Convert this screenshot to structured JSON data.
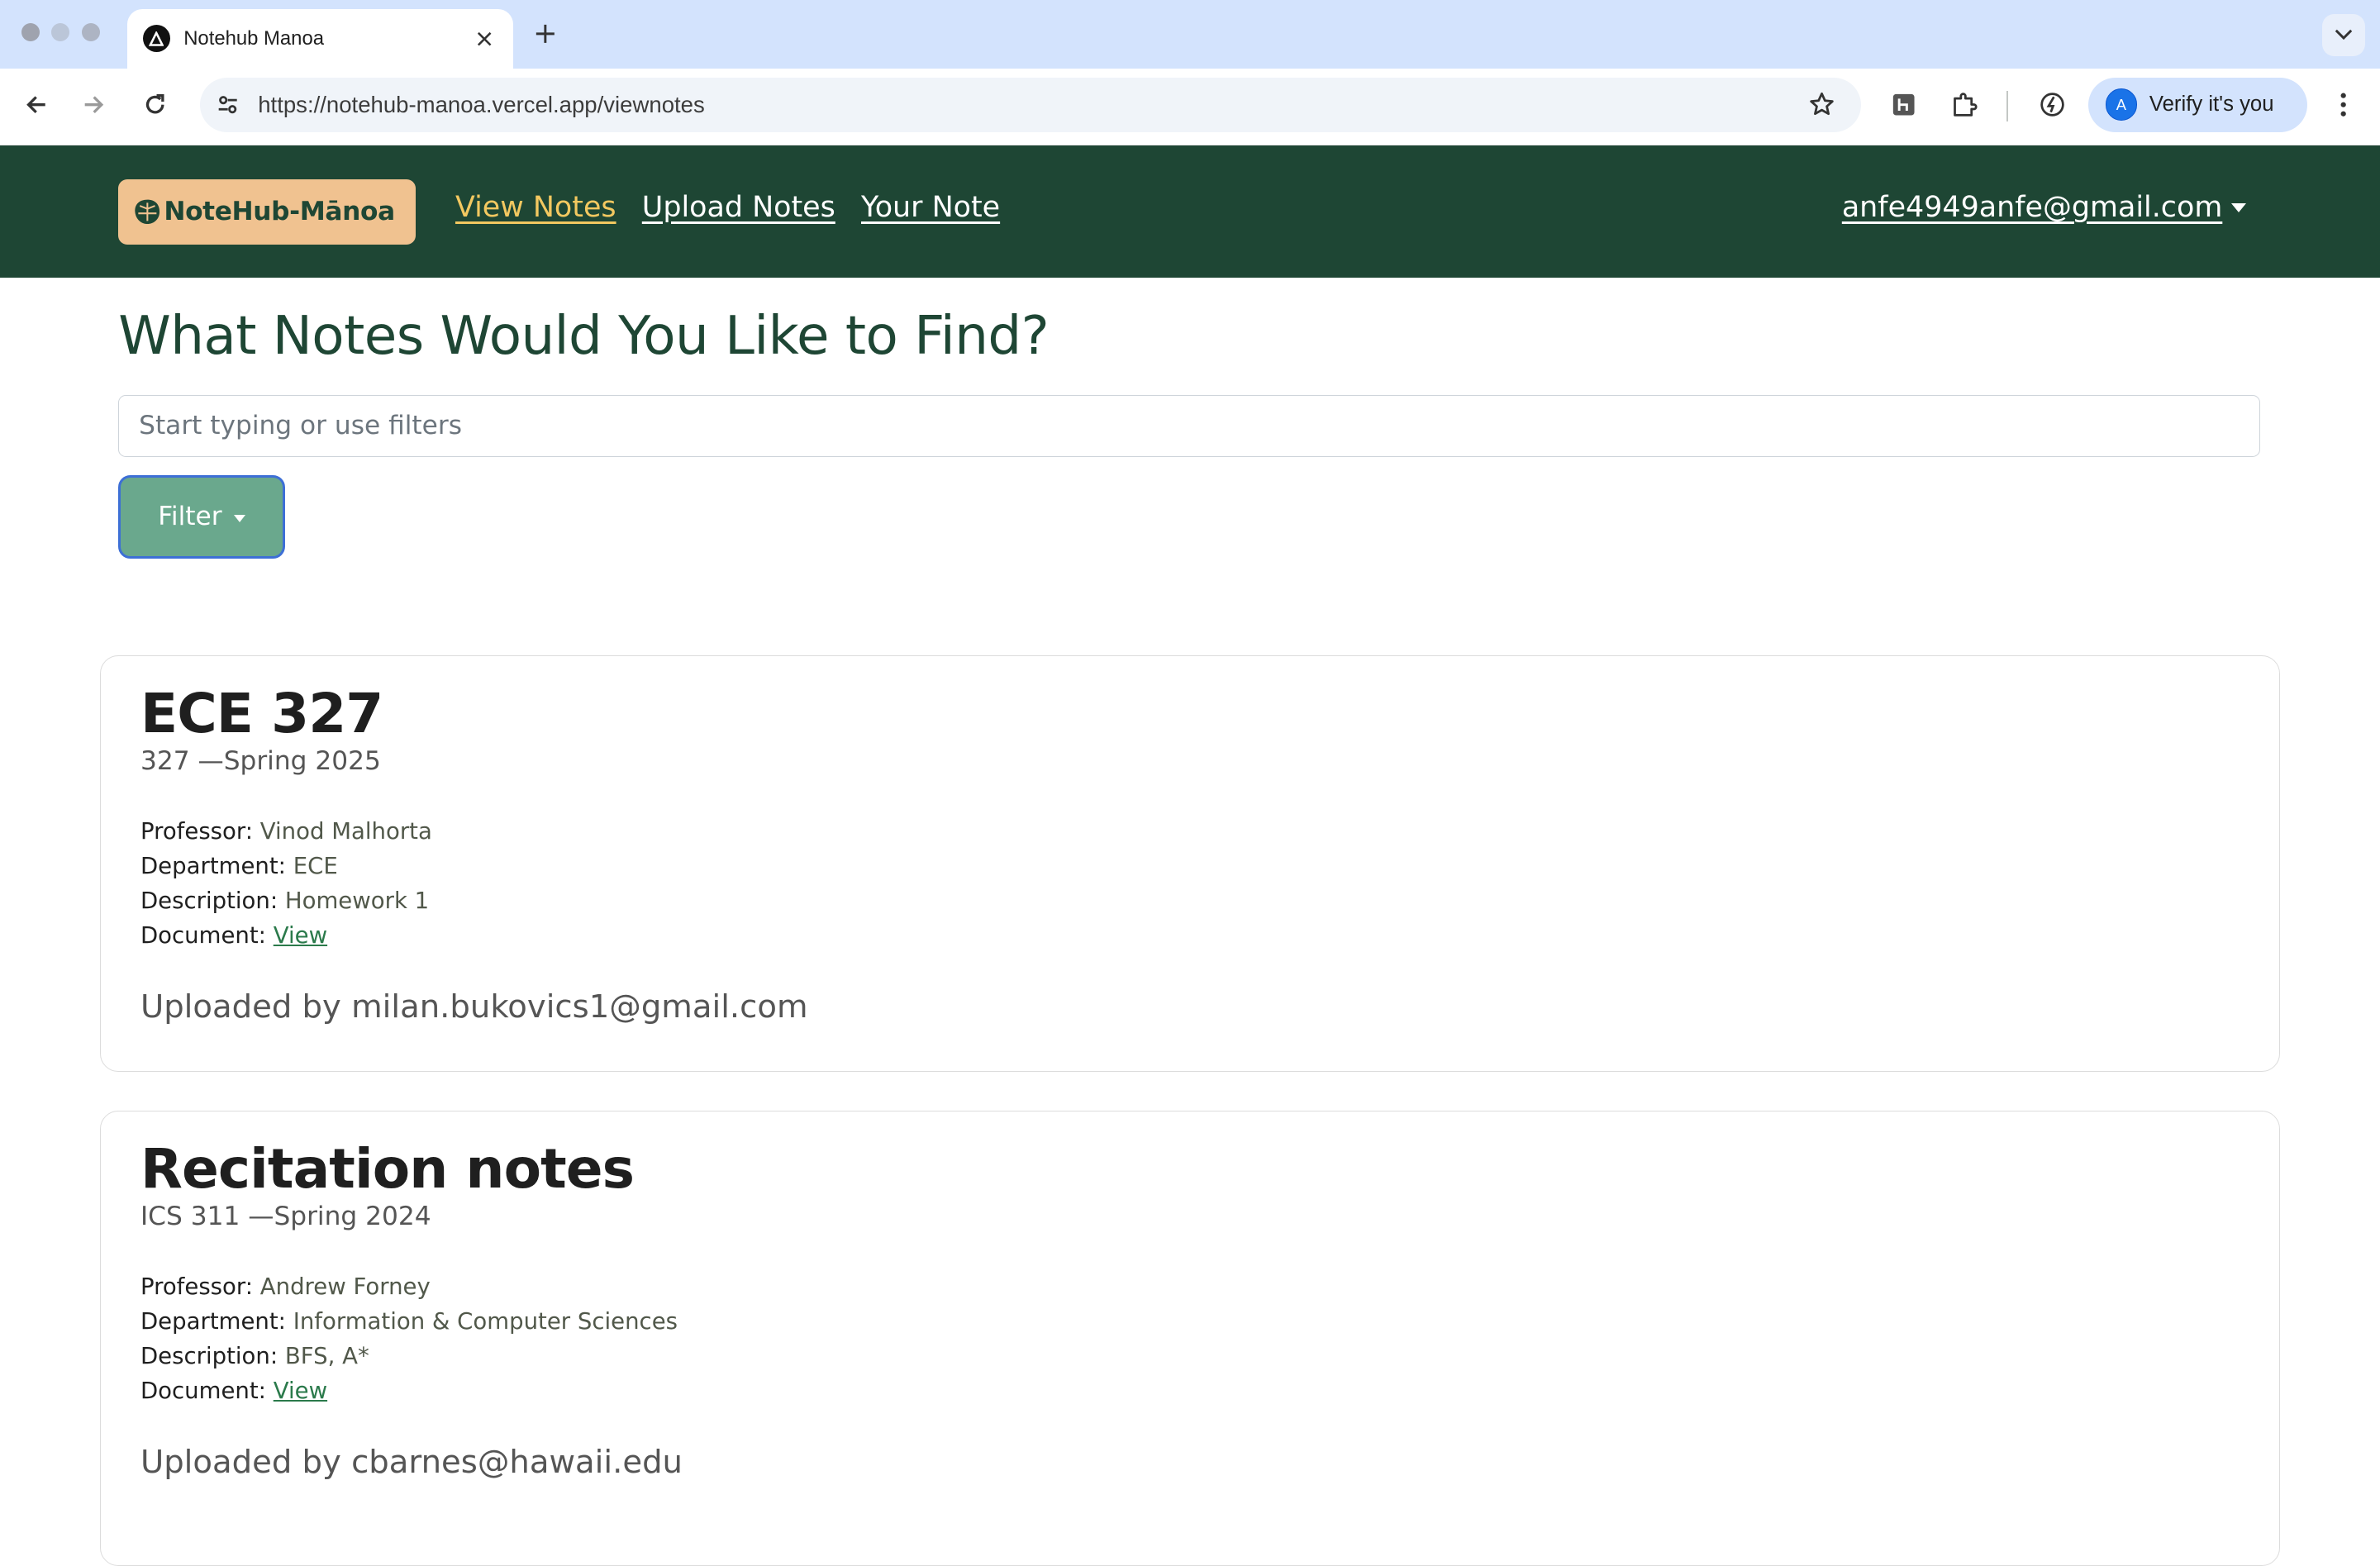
{
  "browser": {
    "tab_title": "Notehub Manoa",
    "url": "https://notehub-manoa.vercel.app/viewnotes",
    "profile_button_label": "Verify it's you",
    "icons": [
      "back-icon",
      "forward-icon",
      "reload-icon",
      "tune-icon",
      "star-icon",
      "extension-h-icon",
      "puzzle-icon",
      "performance-icon",
      "kebab-menu-icon",
      "new-tab-icon",
      "tab-search-icon",
      "close-icon"
    ]
  },
  "site": {
    "brand": "NoteHub-Mānoa",
    "nav": [
      {
        "label": "View Notes",
        "active": true
      },
      {
        "label": "Upload Notes",
        "active": false
      },
      {
        "label": "Your Note",
        "active": false
      }
    ],
    "user_email": "anfe4949anfe@gmail.com",
    "colors": {
      "navbar": "#1e4634",
      "brand_bg": "#f0c290",
      "active_link": "#f3c860",
      "filter_button": "#6aa88d"
    }
  },
  "page": {
    "title": "What Notes Would You Like to Find?",
    "search_placeholder": "Start typing or use filters",
    "filter_label": "Filter"
  },
  "field_labels": {
    "professor": "Professor:",
    "department": "Department:",
    "description": "Description:",
    "document": "Document:"
  },
  "notes": [
    {
      "title": "ECE 327",
      "subtitle": "327 —Spring 2025",
      "professor": "Vinod Malhorta",
      "department": "ECE",
      "description": "Homework 1",
      "document_link": "View",
      "uploaded_by": "Uploaded by milan.bukovics1@gmail.com"
    },
    {
      "title": "Recitation notes",
      "subtitle": "ICS 311 —Spring 2024",
      "professor": "Andrew Forney",
      "department": "Information & Computer Sciences",
      "description": "BFS, A*",
      "document_link": "View",
      "uploaded_by": "Uploaded by cbarnes@hawaii.edu"
    }
  ]
}
